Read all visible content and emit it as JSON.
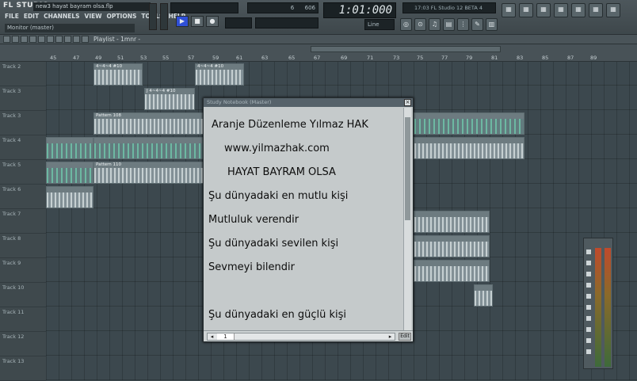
{
  "app": {
    "logo": "FL STUDIO",
    "filename": "new3 hayat bayram olsa.flp"
  },
  "menu": [
    "FILE",
    "EDIT",
    "CHANNELS",
    "VIEW",
    "OPTIONS",
    "TOOLS",
    "HELP"
  ],
  "monitor": "Monitor (master)",
  "transport": {
    "play": "▶",
    "stop": "■",
    "record": "●"
  },
  "counters": {
    "tempo": "606",
    "pattern": "6"
  },
  "time_display": "1:01:000",
  "hint_bar": "17:03 FL Studio 12 BETA 4",
  "line_mode": "Line",
  "playlist": {
    "title": "Playlist - 1mnr -"
  },
  "ruler_ticks": [
    "45",
    "47",
    "49",
    "51",
    "53",
    "55",
    "57",
    "59",
    "61",
    "63",
    "65",
    "67",
    "69",
    "71",
    "73",
    "75",
    "77",
    "79",
    "81",
    "83",
    "85",
    "87",
    "89"
  ],
  "tracks": [
    "Track 2",
    "Track 3",
    "Track 3",
    "Track 4",
    "Track 5",
    "Track 6",
    "Track 7",
    "Track 8",
    "Track 9",
    "Track 10",
    "Track 11",
    "Track 12",
    "Track 13"
  ],
  "clips": {
    "pattern_108": "Pattern 108",
    "pattern_110": "Pattern 110",
    "notes_a": "J 4~4~4 #10",
    "notes_b": "4~4~4 #10"
  },
  "notebook": {
    "title": "Study Notebook (Master)",
    "lines": [
      "Aranje Düzenleme Yılmaz HAK",
      "www.yilmazhak.com",
      "HAYAT BAYRAM OLSA",
      "Şu dünyadaki en mutlu kişi",
      "Mutluluk verendir",
      "Şu dünyadaki sevilen kişi",
      "Sevmeyi bilendir",
      "",
      "Şu dünyadaki en güçlü kişi"
    ],
    "page": "1",
    "edit_label": "Edit",
    "close": "×"
  }
}
